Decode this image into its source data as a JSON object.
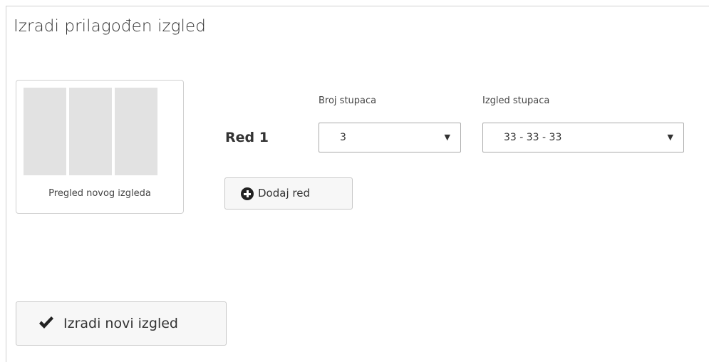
{
  "title": "Izradi prilagođen izgled",
  "preview": {
    "caption": "Pregled novog izgleda",
    "columns": 3,
    "column_color": "#e2e2e2"
  },
  "row": {
    "label": "Red 1",
    "columns_count": {
      "label": "Broj stupaca",
      "value": "3"
    },
    "columns_layout": {
      "label": "Izgled stupaca",
      "value": "33 - 33 - 33"
    }
  },
  "buttons": {
    "add_row": "Dodaj red",
    "create_layout": "Izradi novi izgled"
  },
  "icons": {
    "add_row": "plus-circle-icon",
    "create_layout": "checkmark-icon",
    "select_arrow": "caret-down-icon"
  }
}
